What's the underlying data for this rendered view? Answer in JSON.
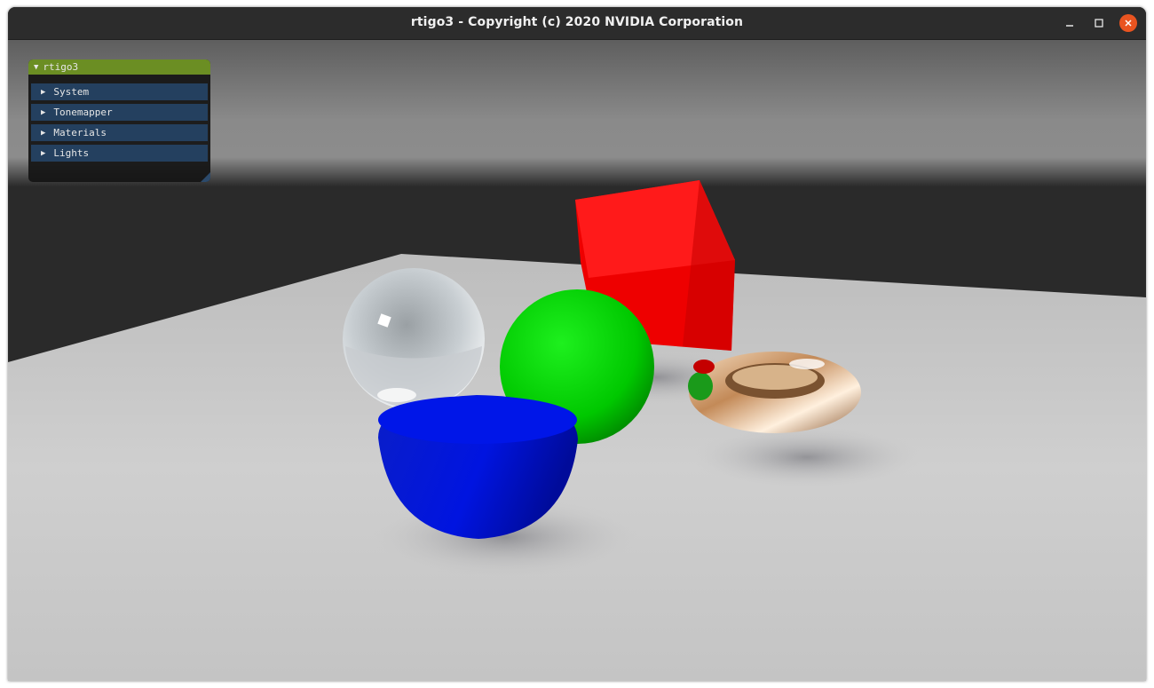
{
  "window": {
    "title": "rtigo3 - Copyright (c) 2020 NVIDIA Corporation",
    "controls": {
      "minimize_icon": "minimize-icon",
      "maximize_icon": "maximize-icon",
      "close_icon": "close-icon",
      "close_color": "#e95420"
    }
  },
  "gui": {
    "panel_title": "rtigo3",
    "header_color": "#6b8e23",
    "item_color": "#24405f",
    "sections": [
      {
        "label": "System"
      },
      {
        "label": "Tonemapper"
      },
      {
        "label": "Materials"
      },
      {
        "label": "Lights"
      }
    ]
  },
  "scene": {
    "objects": [
      {
        "name": "glass sphere",
        "color": "#d8dde0"
      },
      {
        "name": "red cube",
        "color": "#e00000"
      },
      {
        "name": "green sphere",
        "color": "#00cc00"
      },
      {
        "name": "blue hemisphere",
        "color": "#0014d0"
      },
      {
        "name": "metal torus",
        "color": "#c89a6a"
      }
    ],
    "floor_color": "#c6c6c6",
    "background_color": "#2a2a2a"
  }
}
